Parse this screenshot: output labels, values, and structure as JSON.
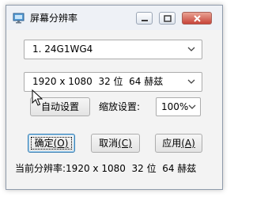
{
  "window": {
    "title": "屏幕分辨率"
  },
  "monitor_select": {
    "value": "1. 24G1WG4"
  },
  "mode_select": {
    "value": "1920 x 1080  32 位  64 赫兹"
  },
  "auto_button": {
    "label": "自动设置"
  },
  "zoom": {
    "label": "缩放设置:",
    "value": "100%"
  },
  "buttons": {
    "ok_label": "确定",
    "ok_key": "(O)",
    "cancel_label": "取消",
    "cancel_key": "(C)",
    "apply_label": "应用",
    "apply_key": "(A)"
  },
  "status": {
    "text": "当前分辨率:1920 x 1080  32 位  64 赫兹"
  },
  "icons": {
    "app": "monitor-icon",
    "minimize": "minimize-icon",
    "maximize": "maximize-icon",
    "close": "close-icon",
    "dropdown": "chevron-down-icon",
    "cursor": "mouse-pointer-icon"
  }
}
